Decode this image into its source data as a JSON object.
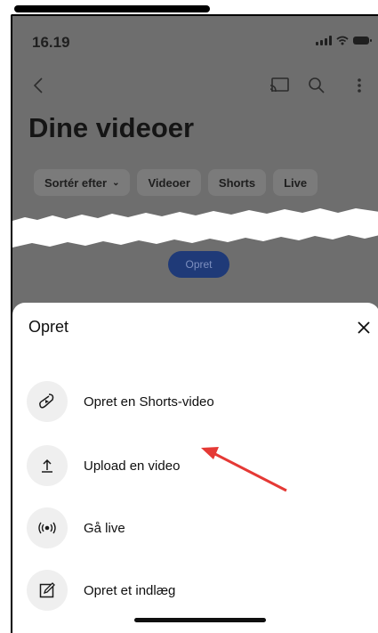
{
  "status_bar": {
    "time": "16.19"
  },
  "header": {
    "title": "Dine videoer",
    "icons": [
      "back-icon",
      "cast-icon",
      "search-icon",
      "more-vert-icon"
    ]
  },
  "chips": [
    {
      "label": "Sortér efter",
      "has_caret": true
    },
    {
      "label": "Videoer"
    },
    {
      "label": "Shorts"
    },
    {
      "label": "Live"
    }
  ],
  "background_button": {
    "label": "Opret"
  },
  "sheet": {
    "title": "Opret",
    "items": [
      {
        "label": "Opret en Shorts-video",
        "icon": "shorts-icon"
      },
      {
        "label": "Upload en video",
        "icon": "upload-icon"
      },
      {
        "label": "Gå live",
        "icon": "live-icon"
      },
      {
        "label": "Opret et indlæg",
        "icon": "edit-post-icon"
      }
    ]
  },
  "colors": {
    "dim_overlay": "#6e6e6e",
    "create_pill": "#1f3a78",
    "annotation_arrow": "#e53935"
  }
}
